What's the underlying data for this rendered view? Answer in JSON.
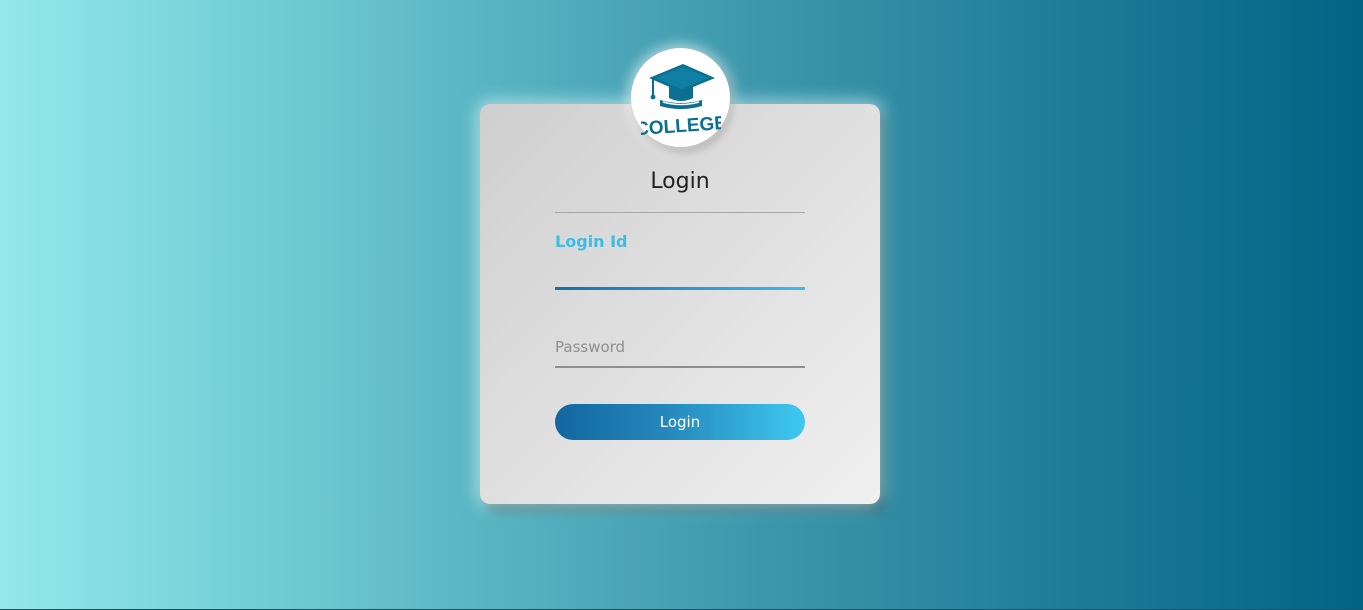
{
  "logo": {
    "icon": "graduation-cap-icon",
    "text": "COLLEGE",
    "color": "#0a6f91"
  },
  "login_form": {
    "title": "Login",
    "login_id": {
      "label": "Login Id",
      "value": ""
    },
    "password": {
      "placeholder": "Password",
      "value": ""
    },
    "submit_label": "Login"
  },
  "colors": {
    "background_start": "#95e8ea",
    "background_end": "#046385",
    "accent": "#3bbde6",
    "button_start": "#1366a0",
    "button_end": "#3ec9ef"
  }
}
